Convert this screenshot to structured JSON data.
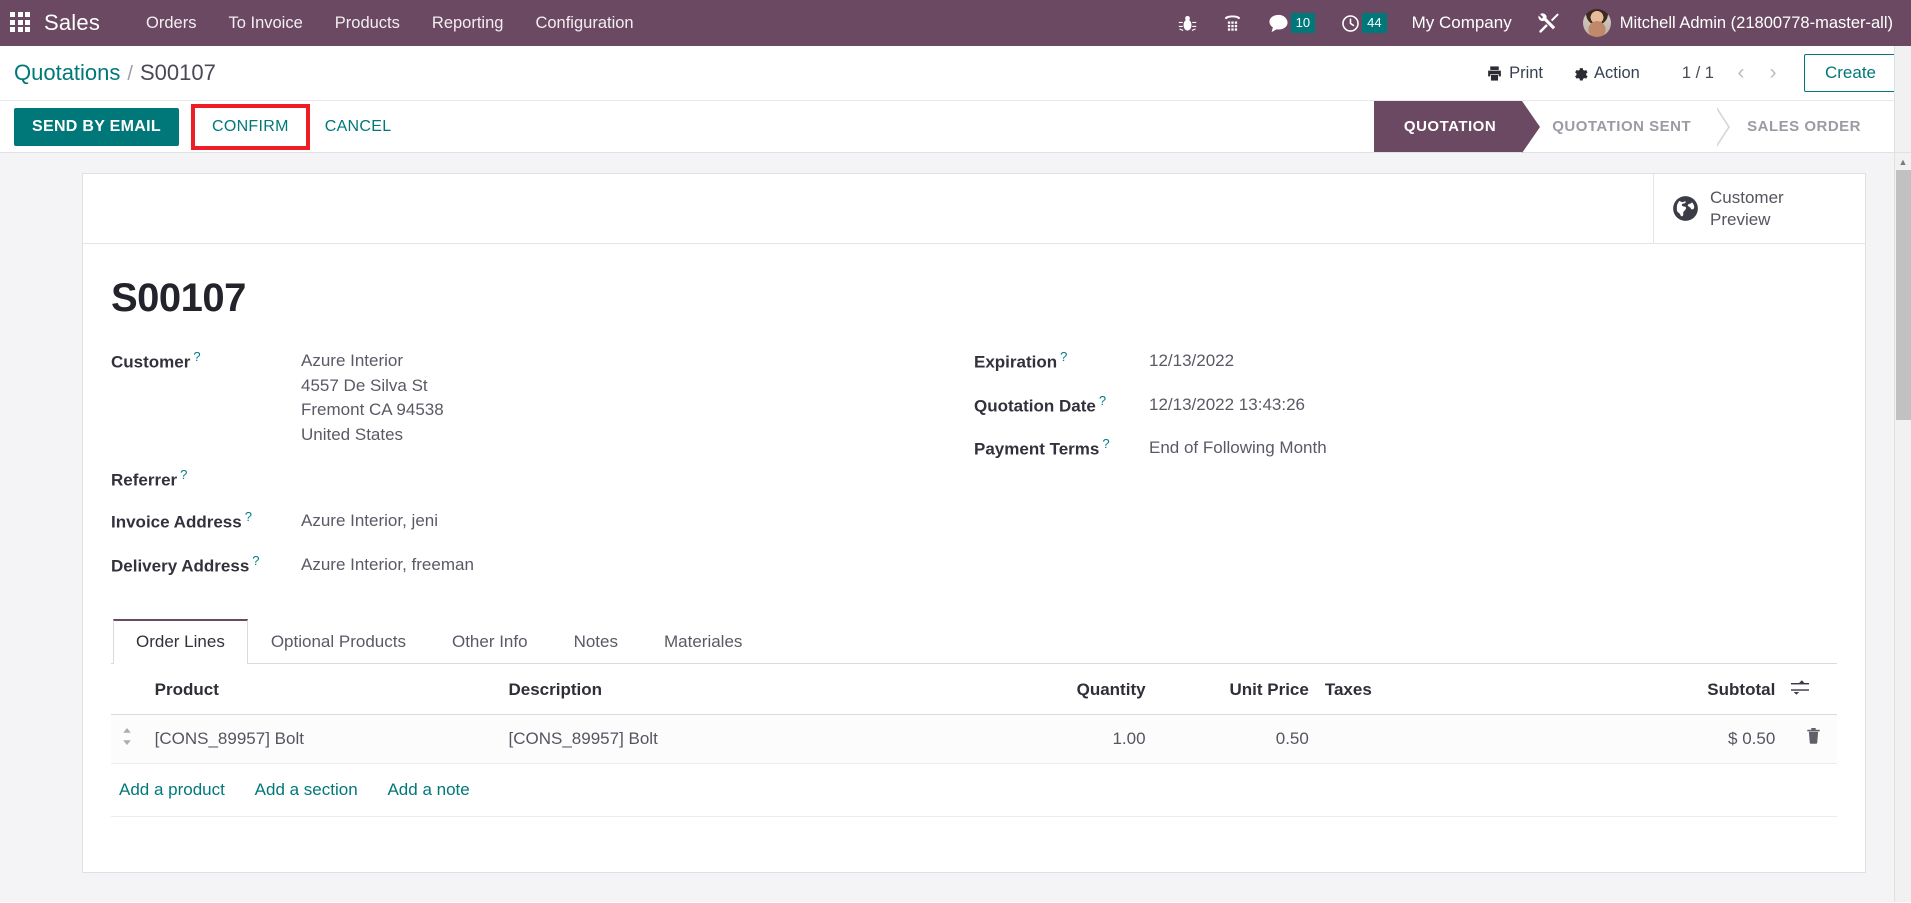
{
  "navbar": {
    "apps_icon": "apps-grid-icon",
    "brand": "Sales",
    "menu": [
      {
        "label": "Orders"
      },
      {
        "label": "To Invoice"
      },
      {
        "label": "Products"
      },
      {
        "label": "Reporting"
      },
      {
        "label": "Configuration"
      }
    ],
    "icons": [
      {
        "name": "bug-icon",
        "badge": null
      },
      {
        "name": "dialpad-icon",
        "badge": null
      },
      {
        "name": "messaging-icon",
        "badge": "10"
      },
      {
        "name": "activities-clock-icon",
        "badge": "44"
      }
    ],
    "company": "My Company",
    "tools_icon": "tools-icon",
    "user": "Mitchell Admin (21800778-master-all)",
    "accent_bg": "#6b4962",
    "badge_color": "#00787a"
  },
  "control_panel": {
    "breadcrumb": {
      "root": "Quotations",
      "separator": "/",
      "current": "S00107"
    },
    "print_label": "Print",
    "action_label": "Action",
    "pager": "1 / 1",
    "prev_arrow": "‹",
    "next_arrow": "›",
    "create_label": "Create",
    "buttons": {
      "send_by_email": "SEND BY EMAIL",
      "confirm": "CONFIRM",
      "cancel": "CANCEL",
      "highlight_color": "#ee1c25"
    },
    "statusbar": [
      {
        "label": "QUOTATION",
        "active": true
      },
      {
        "label": "QUOTATION SENT",
        "active": false
      },
      {
        "label": "SALES ORDER",
        "active": false
      }
    ]
  },
  "sheet": {
    "stat_button": {
      "icon": "globe-icon",
      "line1": "Customer",
      "line2": "Preview"
    },
    "title": "S00107",
    "left_fields": [
      {
        "label": "Customer",
        "help": "?",
        "lines": [
          "Azure Interior",
          "4557 De Silva St",
          "Fremont CA 94538",
          "United States"
        ]
      },
      {
        "label": "Referrer",
        "help": "?",
        "lines": [
          ""
        ]
      },
      {
        "label": "Invoice Address",
        "help": "?",
        "lines": [
          "Azure Interior, jeni"
        ]
      },
      {
        "label": "Delivery Address",
        "help": "?",
        "lines": [
          "Azure Interior, freeman"
        ]
      }
    ],
    "right_fields": [
      {
        "label": "Expiration",
        "help": "?",
        "lines": [
          "12/13/2022"
        ]
      },
      {
        "label": "Quotation Date",
        "help": "?",
        "lines": [
          "12/13/2022 13:43:26"
        ]
      },
      {
        "label": "Payment Terms",
        "help": "?",
        "lines": [
          "End of Following Month"
        ]
      }
    ],
    "tabs": [
      {
        "label": "Order Lines",
        "active": true
      },
      {
        "label": "Optional Products",
        "active": false
      },
      {
        "label": "Other Info",
        "active": false
      },
      {
        "label": "Notes",
        "active": false
      },
      {
        "label": "Materiales",
        "active": false
      }
    ],
    "lines_table": {
      "headers": {
        "product": "Product",
        "description": "Description",
        "quantity": "Quantity",
        "unit_price": "Unit Price",
        "taxes": "Taxes",
        "subtotal": "Subtotal"
      },
      "optional_columns_icon": "column-options-icon",
      "rows": [
        {
          "handle": "drag-handle-icon",
          "product": "[CONS_89957] Bolt",
          "description": "[CONS_89957] Bolt",
          "quantity": "1.00",
          "unit_price": "0.50",
          "taxes": "",
          "subtotal": "$ 0.50",
          "delete_icon": "trash-icon"
        }
      ],
      "add_links": [
        {
          "label": "Add a product"
        },
        {
          "label": "Add a section"
        },
        {
          "label": "Add a note"
        }
      ]
    }
  }
}
